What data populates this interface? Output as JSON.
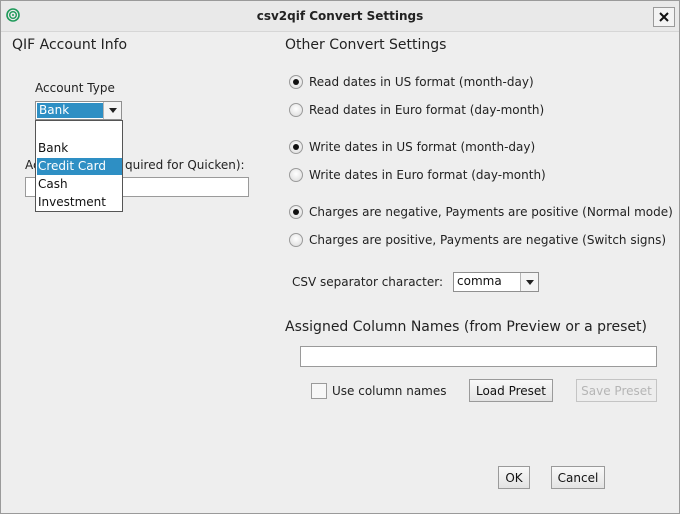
{
  "window": {
    "title": "csv2qif Convert Settings",
    "close": "✕"
  },
  "qif": {
    "section_title": "QIF Account Info",
    "account_type_label": "Account Type",
    "account_type_value": "Bank",
    "dropdown_options": [
      "Bank",
      "Credit Card",
      "Cash",
      "Investment"
    ],
    "selected_option": "Credit Card",
    "account_name_label_left": "Ac",
    "account_name_label_right": "quired for Quicken):",
    "account_name_value": ""
  },
  "other": {
    "section_title": "Other Convert Settings",
    "read_us": "Read dates in US format (month-day)",
    "read_euro": "Read dates in Euro format (day-month)",
    "write_us": "Write dates in US format (month-day)",
    "write_euro": "Write dates in Euro format (day-month)",
    "charges_negative": "Charges are negative, Payments are positive (Normal mode)",
    "charges_positive": "Charges are positive, Payments are negative (Switch signs)",
    "csv_sep_label": "CSV separator character:",
    "csv_sep_value": "comma"
  },
  "columns": {
    "section_title": "Assigned Column Names (from Preview or a preset)",
    "value": "",
    "use_column_names": "Use column names",
    "load_preset": "Load Preset",
    "save_preset": "Save Preset"
  },
  "footer": {
    "ok": "OK",
    "cancel": "Cancel"
  },
  "colors": {
    "selection": "#2e8fc4",
    "background": "#eeeeee"
  }
}
